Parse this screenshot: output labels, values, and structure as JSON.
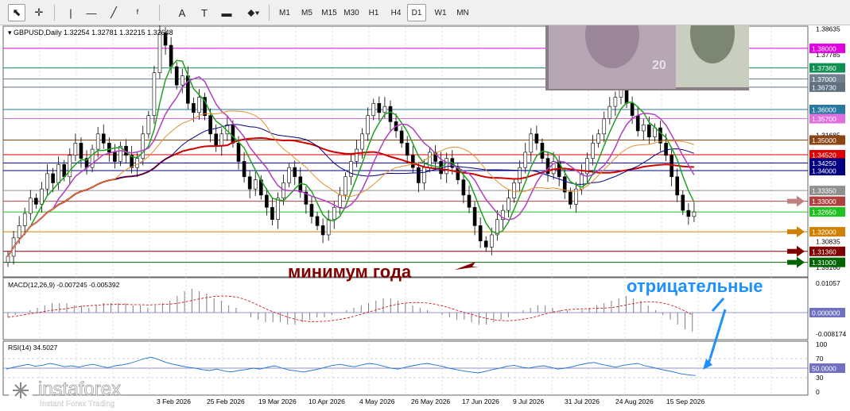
{
  "toolbar": {
    "tools": [
      {
        "name": "cursor-tool-icon",
        "glyph": "⬉"
      },
      {
        "name": "crosshair-tool-icon",
        "glyph": "✛"
      },
      {
        "name": "vertical-line-tool-icon",
        "glyph": "|"
      },
      {
        "name": "horizontal-line-tool-icon",
        "glyph": "—"
      },
      {
        "name": "trend-line-tool-icon",
        "glyph": "╱"
      },
      {
        "name": "fibonacci-tool-icon",
        "glyph": "ᶠ"
      },
      {
        "name": "text-tool-icon",
        "glyph": "A"
      },
      {
        "name": "text-label-tool-icon",
        "glyph": "T"
      },
      {
        "name": "rectangle-tool-icon",
        "glyph": "▬"
      },
      {
        "name": "shapes-menu-icon",
        "glyph": "⬥▾"
      }
    ],
    "timeframes": [
      "M1",
      "M5",
      "M15",
      "M30",
      "H1",
      "H4",
      "D1",
      "W1",
      "MN"
    ],
    "active_timeframe": "D1"
  },
  "chart_data": {
    "type": "candlestick",
    "symbol_info": "GBPUSD,Daily  1.32254 1.32781 1.32215 1.32648",
    "price_axis_labels": [
      "1.38635",
      "1.37785",
      "1.36800",
      "1.31685",
      "1.30835",
      "1.35160"
    ],
    "price_ticks_shown": [
      1.38635,
      1.37785,
      1.368,
      1.3516,
      1.31685,
      1.30835
    ],
    "level_lines": [
      {
        "value": "1.38000",
        "color": "#e000e0"
      },
      {
        "value": "1.37360",
        "color": "#109050"
      },
      {
        "value": "1.37000",
        "color": "#708090"
      },
      {
        "value": "1.36730",
        "color": "#607080"
      },
      {
        "value": "1.36000",
        "color": "#2878a0"
      },
      {
        "value": "1.35700",
        "color": "#e070e0"
      },
      {
        "value": "1.35000",
        "color": "#8b4513"
      },
      {
        "value": "1.34520",
        "color": "#e00000"
      },
      {
        "value": "1.34250",
        "color": "#000080"
      },
      {
        "value": "1.34000",
        "color": "#000080"
      },
      {
        "value": "1.33350",
        "color": "#909090"
      },
      {
        "value": "1.33000",
        "color": "#b04040"
      },
      {
        "value": "1.32650",
        "color": "#20c020"
      },
      {
        "value": "1.32000",
        "color": "#d08000"
      },
      {
        "value": "1.31360",
        "color": "#800000"
      },
      {
        "value": "1.31000",
        "color": "#006400"
      }
    ],
    "price_range": [
      1.3055,
      1.3875
    ],
    "close_series": [
      1.312,
      1.318,
      1.322,
      1.326,
      1.331,
      1.329,
      1.334,
      1.339,
      1.336,
      1.342,
      1.338,
      1.345,
      1.349,
      1.344,
      1.341,
      1.347,
      1.352,
      1.349,
      1.346,
      1.343,
      1.348,
      1.345,
      1.341,
      1.344,
      1.352,
      1.358,
      1.372,
      1.385,
      1.381,
      1.374,
      1.368,
      1.371,
      1.362,
      1.359,
      1.364,
      1.358,
      1.352,
      1.348,
      1.352,
      1.355,
      1.349,
      1.343,
      1.338,
      1.334,
      1.337,
      1.332,
      1.328,
      1.324,
      1.331,
      1.336,
      1.341,
      1.338,
      1.333,
      1.329,
      1.325,
      1.322,
      1.319,
      1.324,
      1.328,
      1.332,
      1.338,
      1.343,
      1.347,
      1.352,
      1.358,
      1.362,
      1.359,
      1.361,
      1.356,
      1.353,
      1.349,
      1.345,
      1.341,
      1.336,
      1.341,
      1.346,
      1.343,
      1.339,
      1.344,
      1.341,
      1.337,
      1.332,
      1.328,
      1.322,
      1.317,
      1.315,
      1.319,
      1.324,
      1.327,
      1.331,
      1.336,
      1.341,
      1.346,
      1.352,
      1.349,
      1.344,
      1.339,
      1.343,
      1.338,
      1.333,
      1.329,
      1.334,
      1.339,
      1.344,
      1.349,
      1.352,
      1.357,
      1.361,
      1.364,
      1.367,
      1.362,
      1.358,
      1.353,
      1.355,
      1.351,
      1.354,
      1.349,
      1.345,
      1.338,
      1.332,
      1.327,
      1.325,
      1.3265
    ],
    "moving_averages": [
      "red",
      "dark-blue",
      "green",
      "violet",
      "orange"
    ],
    "date_labels": [
      "3 Feb 2026",
      "25 Feb 2026",
      "19 Mar 2026",
      "10 Apr 2026",
      "4 May 2026",
      "26 May 2026",
      "17 Jun 2026",
      "9 Jul 2026",
      "31 Jul 2026",
      "24 Aug 2026",
      "15 Sep 2026"
    ],
    "annotations": {
      "year_low": "минимум года",
      "negative": "отрицательные"
    },
    "macd": {
      "label": "MACD(12,26,9) -0.007245 -0.005392",
      "axis_labels": [
        "0.01057",
        "0.000000",
        "-0.008174"
      ],
      "histogram": [
        -0.002,
        -0.001,
        0.0,
        0.001,
        0.002,
        0.003,
        0.004,
        0.004,
        0.004,
        0.003,
        0.003,
        0.002,
        0.003,
        0.004,
        0.004,
        0.004,
        0.004,
        0.003,
        0.003,
        0.002,
        0.003,
        0.004,
        0.005,
        0.007,
        0.009,
        0.01,
        0.009,
        0.008,
        0.006,
        0.005,
        0.003,
        0.002,
        0.0,
        -0.002,
        -0.003,
        -0.004,
        -0.004,
        -0.004,
        -0.005,
        -0.005,
        -0.004,
        -0.003,
        -0.002,
        -0.002,
        -0.001,
        0.0,
        0.001,
        0.002,
        0.003,
        0.004,
        0.005,
        0.006,
        0.006,
        0.005,
        0.004,
        0.003,
        0.002,
        0.001,
        0.0,
        -0.001,
        -0.002,
        -0.003,
        -0.003,
        -0.004,
        -0.005,
        -0.005,
        -0.004,
        -0.003,
        -0.002,
        0.0,
        0.001,
        0.002,
        0.003,
        0.003,
        0.002,
        0.001,
        0.001,
        0.0,
        0.001,
        0.002,
        0.003,
        0.004,
        0.005,
        0.006,
        0.007,
        0.006,
        0.005,
        0.003,
        0.001,
        -0.001,
        -0.003,
        -0.005,
        -0.007,
        -0.008
      ]
    },
    "rsi": {
      "label": "RSI(14) 34.5027",
      "axis_labels": [
        "100",
        "70",
        "50.0000",
        "30",
        "0"
      ],
      "levels": [
        70,
        50,
        30
      ],
      "values": [
        48,
        52,
        55,
        58,
        54,
        56,
        60,
        57,
        53,
        55,
        52,
        56,
        58,
        54,
        51,
        55,
        57,
        60,
        65,
        70,
        73,
        68,
        62,
        58,
        55,
        52,
        50,
        47,
        45,
        48,
        44,
        42,
        45,
        47,
        50,
        48,
        52,
        55,
        50,
        46,
        44,
        42,
        45,
        48,
        52,
        56,
        58,
        55,
        53,
        57,
        60,
        58,
        54,
        50,
        48,
        52,
        55,
        58,
        60,
        57,
        54,
        50,
        47,
        44,
        42,
        40,
        43,
        47,
        50,
        54,
        56,
        52,
        50,
        53,
        55,
        52,
        48,
        50,
        53,
        57,
        60,
        62,
        58,
        55,
        52,
        56,
        58,
        60,
        55,
        52,
        48,
        45,
        42,
        38,
        36,
        34.5
      ]
    },
    "watermark": {
      "brand": "instaforex",
      "tagline": "Instant Forex Trading"
    }
  }
}
